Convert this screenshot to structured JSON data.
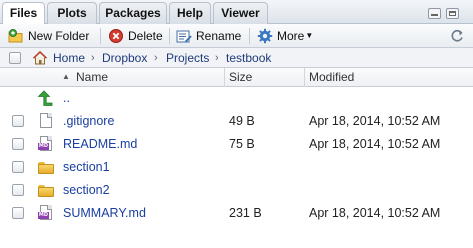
{
  "tabs": [
    "Files",
    "Plots",
    "Packages",
    "Help",
    "Viewer"
  ],
  "toolbar": {
    "new_folder": "New Folder",
    "delete": "Delete",
    "rename": "Rename",
    "more": "More"
  },
  "breadcrumb": [
    "Home",
    "Dropbox",
    "Projects",
    "testbook"
  ],
  "columns": {
    "name": "Name",
    "size": "Size",
    "modified": "Modified"
  },
  "parent_dir": "..",
  "files": [
    {
      "name": ".gitignore",
      "type": "text-file-icon",
      "size": "49 B",
      "modified": "Apr 18, 2014, 10:52 AM"
    },
    {
      "name": "README.md",
      "type": "markdown-file-icon",
      "size": "75 B",
      "modified": "Apr 18, 2014, 10:52 AM"
    },
    {
      "name": "section1",
      "type": "folder-icon",
      "size": "",
      "modified": ""
    },
    {
      "name": "section2",
      "type": "folder-icon",
      "size": "",
      "modified": ""
    },
    {
      "name": "SUMMARY.md",
      "type": "markdown-file-icon",
      "size": "231 B",
      "modified": "Apr 18, 2014, 10:52 AM"
    }
  ],
  "colors": {
    "link": "#1a3fa0",
    "breadcrumb": "#1f3b7a",
    "tab_bg": "#dde3ea"
  }
}
